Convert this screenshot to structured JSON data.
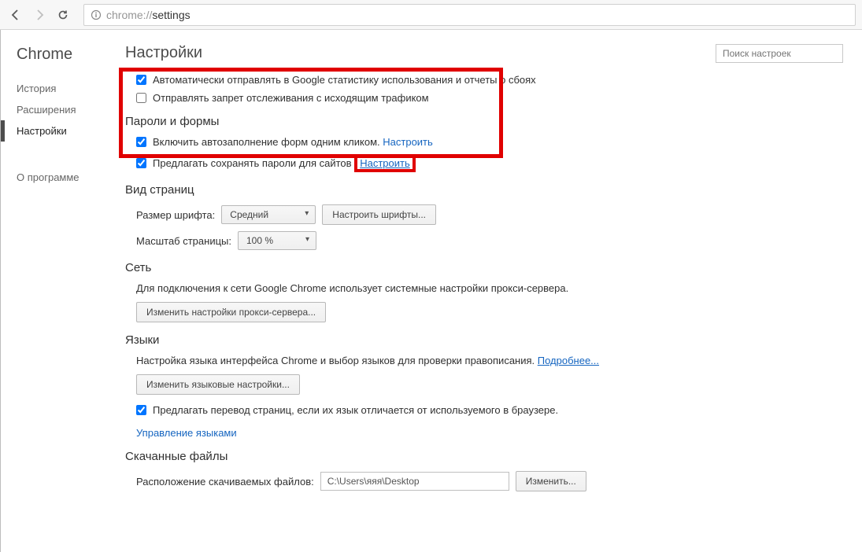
{
  "url": {
    "scheme": "chrome://",
    "path": "settings"
  },
  "sidebar": {
    "title": "Chrome",
    "items": [
      "История",
      "Расширения",
      "Настройки"
    ],
    "about": "О программе",
    "active": 2
  },
  "header": {
    "title": "Настройки",
    "search_placeholder": "Поиск настроек"
  },
  "privacy": {
    "send_stats": "Автоматически отправлять в Google статистику использования и отчеты о сбоях",
    "do_not_track": "Отправлять запрет отслеживания с исходящим трафиком"
  },
  "passwords": {
    "title": "Пароли и формы",
    "autofill": "Включить автозаполнение форм одним кликом.",
    "autofill_link": "Настроить",
    "offer_save": "Предлагать сохранять пароли для сайтов",
    "offer_link": "Настроить"
  },
  "appearance": {
    "title": "Вид страниц",
    "font_label": "Размер шрифта:",
    "font_value": "Средний",
    "font_btn": "Настроить шрифты...",
    "zoom_label": "Масштаб страницы:",
    "zoom_value": "100 %"
  },
  "network": {
    "title": "Сеть",
    "desc": "Для подключения к сети Google Chrome использует системные настройки прокси-сервера.",
    "proxy_btn": "Изменить настройки прокси-сервера..."
  },
  "languages": {
    "title": "Языки",
    "desc": "Настройка языка интерфейса Chrome и выбор языков для проверки правописания.",
    "more": "Подробнее...",
    "btn": "Изменить языковые настройки...",
    "translate": "Предлагать перевод страниц, если их язык отличается от используемого в браузере.",
    "manage": "Управление языками"
  },
  "downloads": {
    "title": "Скачанные файлы",
    "loc_label": "Расположение скачиваемых файлов:",
    "loc_value": "C:\\Users\\яяя\\Desktop",
    "change": "Изменить..."
  }
}
